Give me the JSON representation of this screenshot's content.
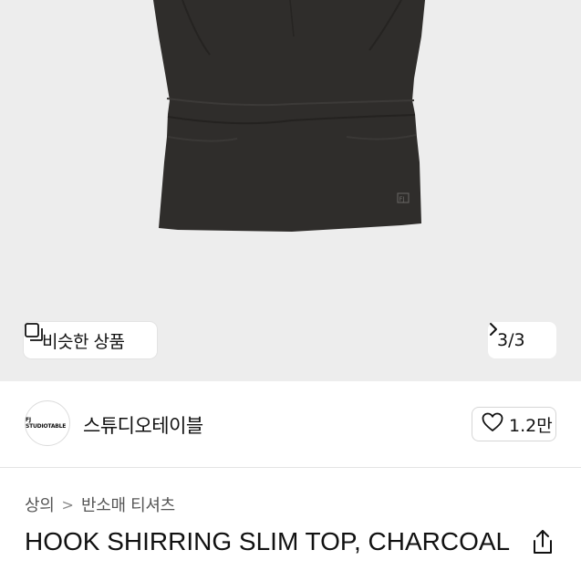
{
  "product_image": {
    "alt_icon": "charcoal-slim-top-photo",
    "background": "#ededed",
    "garment_color": "#2f2d2b",
    "garment_logo": "FJ"
  },
  "similar_button": {
    "label": "비슷한 상품",
    "icon": "similar-items-icon"
  },
  "image_counter": {
    "label": "3/3",
    "icon": "chevron-right-icon"
  },
  "brand": {
    "logo_text": "FJ STUDIOTABLE",
    "name": "스튜디오테이블",
    "likes": "1.2만",
    "like_icon": "heart-outline-icon"
  },
  "breadcrumb": {
    "items": [
      "상의",
      "반소매 티셔츠"
    ],
    "separator": ">"
  },
  "product": {
    "title": "HOOK SHIRRING SLIM TOP, CHARCOAL",
    "share_icon": "share-icon"
  }
}
